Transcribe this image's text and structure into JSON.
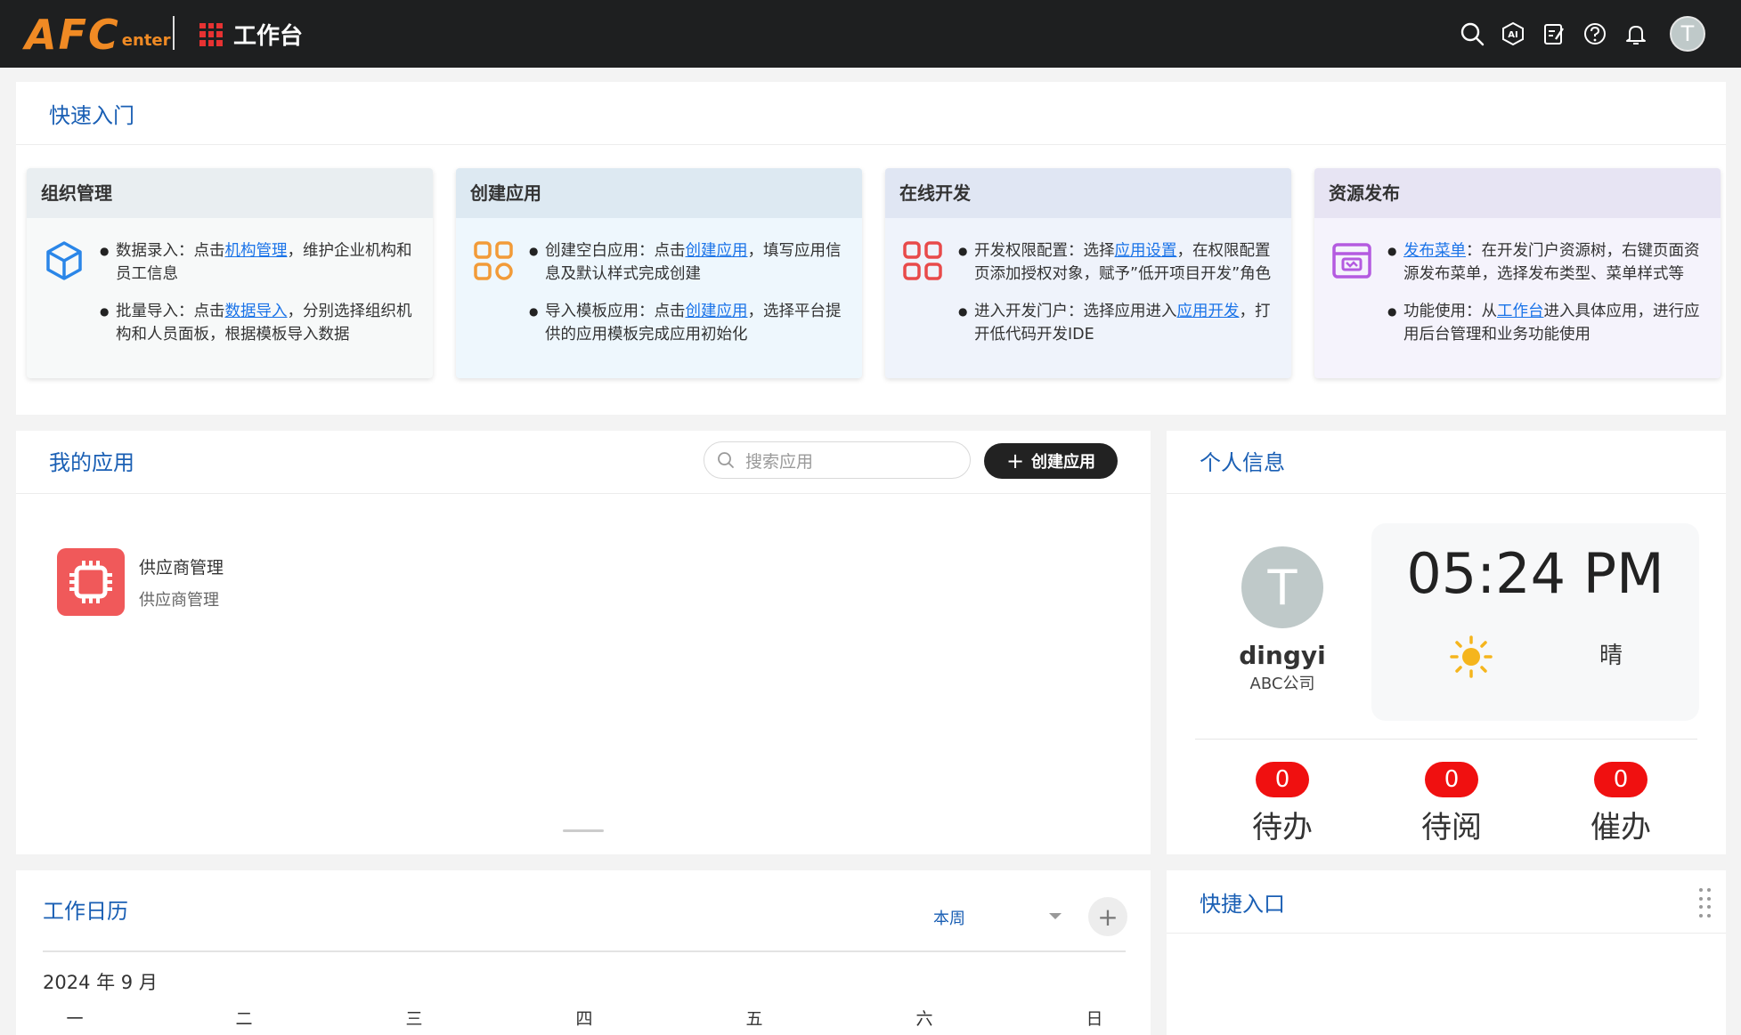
{
  "header": {
    "logo_main": "AFC",
    "logo_sub": "enter",
    "workspace_title": "工作台",
    "icons": [
      "search-icon",
      "ai-icon",
      "edit-icon",
      "help-icon",
      "bell-icon"
    ],
    "avatar_initial": "T"
  },
  "quick_start": {
    "title": "快速入门",
    "cards": [
      {
        "title": "组织管理",
        "icon": "cube-icon",
        "items": [
          {
            "pre": "数据录入：点击",
            "link": "机构管理",
            "post": "，维护企业机构和员工信息"
          },
          {
            "pre": "批量导入：点击",
            "link": "数据导入",
            "post": "，分别选择组织机构和人员面板，根据模板导入数据"
          }
        ]
      },
      {
        "title": "创建应用",
        "icon": "apps-icon",
        "items": [
          {
            "pre": "创建空白应用：点击",
            "link": "创建应用",
            "post": "，填写应用信息及默认样式完成创建"
          },
          {
            "pre": "导入模板应用：点击",
            "link": "创建应用",
            "post": "，选择平台提供的应用模板完成应用初始化"
          }
        ]
      },
      {
        "title": "在线开发",
        "icon": "grid-icon",
        "items": [
          {
            "pre": "开发权限配置：选择",
            "link": "应用设置",
            "post": "，在权限配置页添加授权对象，赋予”低开项目开发”角色"
          },
          {
            "pre": "进入开发门户：选择应用进入",
            "link": "应用开发",
            "post": "，打开低代码开发IDE"
          }
        ]
      },
      {
        "title": "资源发布",
        "icon": "publish-icon",
        "items": [
          {
            "pre": "",
            "link": "发布菜单",
            "post": "：在开发门户资源树，右键页面资源发布菜单，选择发布类型、菜单样式等"
          },
          {
            "pre": "功能使用：从",
            "link": "工作台",
            "post": "进入具体应用，进行应用后台管理和业务功能使用"
          }
        ]
      }
    ]
  },
  "my_apps": {
    "title": "我的应用",
    "search_placeholder": "搜索应用",
    "create_button": "创建应用",
    "apps": [
      {
        "name": "供应商管理",
        "desc": "供应商管理",
        "icon": "chip-icon",
        "color": "#f0595a"
      }
    ]
  },
  "personal": {
    "title": "个人信息",
    "avatar_initial": "T",
    "username": "dingyi",
    "company": "ABC公司",
    "time": "05:24 PM",
    "weather_icon": "sun-icon",
    "weather": "晴",
    "counters": [
      {
        "label": "待办",
        "count": "0"
      },
      {
        "label": "待阅",
        "count": "0"
      },
      {
        "label": "催办",
        "count": "0"
      }
    ]
  },
  "calendar": {
    "title": "工作日历",
    "range": "本周",
    "month": "2024 年 9 月",
    "weekdays": [
      "一",
      "二",
      "三",
      "四",
      "五",
      "六",
      "日"
    ]
  },
  "quick_entry": {
    "title": "快捷入口"
  },
  "colors": {
    "accent": "#1a5fb4",
    "logo": "#f08a24",
    "badge": "#f01010",
    "topbar": "#1e1f20"
  }
}
